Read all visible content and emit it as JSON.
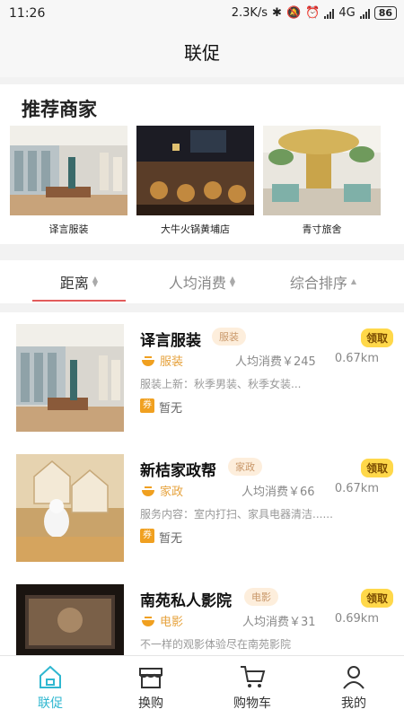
{
  "status": {
    "time": "11:26",
    "speed": "2.3K/s",
    "network": "4G",
    "battery": "86"
  },
  "header": {
    "title": "联促"
  },
  "recommend": {
    "heading": "推荐商家",
    "merchants": [
      {
        "name": "译言服装"
      },
      {
        "name": "大牛火锅黄埔店"
      },
      {
        "name": "青寸旅舍"
      }
    ]
  },
  "sort": {
    "options": [
      {
        "label": "距离"
      },
      {
        "label": "人均消费"
      },
      {
        "label": "综合排序"
      }
    ]
  },
  "list": {
    "items": [
      {
        "name": "译言服装",
        "tag": "服装",
        "claim": "领取",
        "category": "服装",
        "avg": "人均消费￥245",
        "distance": "0.67km",
        "desc": "服装上新：秋季男装、秋季女装...",
        "coupon_badge": "券",
        "coupon_text": "暂无"
      },
      {
        "name": "新桔家政帮",
        "tag": "家政",
        "claim": "领取",
        "category": "家政",
        "avg": "人均消费￥66",
        "distance": "0.67km",
        "desc": "服务内容：室内打扫、家具电器清洁......",
        "coupon_badge": "券",
        "coupon_text": "暂无"
      },
      {
        "name": "南苑私人影院",
        "tag": "电影",
        "claim": "领取",
        "category": "电影",
        "avg": "人均消费￥31",
        "distance": "0.69km",
        "desc": "不一样的观影体验尽在南苑影院",
        "coupon_badge": "",
        "coupon_text": ""
      }
    ]
  },
  "tabs": [
    {
      "label": "联促",
      "icon": "home-icon"
    },
    {
      "label": "换购",
      "icon": "store-icon"
    },
    {
      "label": "购物车",
      "icon": "cart-icon"
    },
    {
      "label": "我的",
      "icon": "user-icon"
    }
  ],
  "colors": {
    "accent": "#2fb7d0",
    "claim": "#ffd84a",
    "tag_bg": "#fdeedc",
    "category": "#e6a23c",
    "sort_underline": "#e25c5c"
  }
}
